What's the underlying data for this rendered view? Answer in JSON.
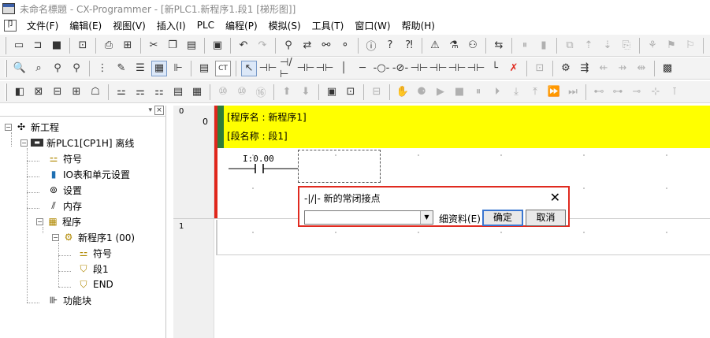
{
  "window": {
    "title": "未命名標題 - CX-Programmer - [新PLC1.新程序1.段1 [梯形图]]"
  },
  "menu": [
    "文件(F)",
    "编辑(E)",
    "视图(V)",
    "插入(I)",
    "PLC",
    "编程(P)",
    "模拟(S)",
    "工具(T)",
    "窗口(W)",
    "帮助(H)"
  ],
  "tree": {
    "items": [
      {
        "label": "新工程",
        "icon": "project-icon"
      },
      {
        "label": "新PLC1[CP1H] 离线",
        "icon": "plc-icon"
      },
      {
        "label": "符号",
        "icon": "symbols-icon"
      },
      {
        "label": "IO表和单元设置",
        "icon": "io-table-icon"
      },
      {
        "label": "设置",
        "icon": "settings-icon"
      },
      {
        "label": "内存",
        "icon": "memory-icon"
      },
      {
        "label": "程序",
        "icon": "programs-icon"
      },
      {
        "label": "新程序1 (00)",
        "icon": "program-icon"
      },
      {
        "label": "符号",
        "icon": "local-symbols-icon"
      },
      {
        "label": "段1",
        "icon": "section-icon"
      },
      {
        "label": "END",
        "icon": "end-section-icon"
      },
      {
        "label": "功能块",
        "icon": "function-block-icon"
      }
    ]
  },
  "ladder": {
    "rung0_number": "0",
    "rung0_step": "0",
    "rung1_number": "1",
    "program_name_line": "[程序名 : 新程序1]",
    "section_name_line": "[段名称 : 段1]",
    "contact_address": "I:0.00"
  },
  "dialog": {
    "title": "-|/|- 新的常闭接点",
    "close_label": "✕",
    "input_value": "",
    "detail_label": "细资料(E)",
    "ok_label": "确定",
    "cancel_label": "取消"
  },
  "colors": {
    "highlight": "#e02a1f",
    "comment_bg": "#ffff00",
    "rail_green": "#2f7d3a"
  }
}
